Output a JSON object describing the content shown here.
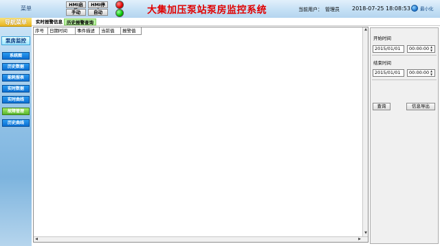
{
  "header": {
    "menu_label": "菜单",
    "buttons": [
      "HMI启动",
      "HMI停止",
      "手动",
      "自动"
    ],
    "title": "大集加压泵站泵房监控系统",
    "user_label": "当前用户：",
    "user_name": "管理员",
    "datetime": "2018-07-25 18:08:53",
    "minimize_label": "最小化",
    "lamp_colors": [
      "#e00000",
      "#00c000"
    ]
  },
  "sidebar": {
    "title": "导航菜单",
    "section": "泵房监控",
    "items": [
      {
        "label": "系统图",
        "active": false
      },
      {
        "label": "历史数据",
        "active": false
      },
      {
        "label": "能耗报表",
        "active": false
      },
      {
        "label": "实时数据",
        "active": false
      },
      {
        "label": "实时曲线",
        "active": false
      },
      {
        "label": "故障管理",
        "active": true
      },
      {
        "label": "历史曲线",
        "active": false
      }
    ]
  },
  "tabs": [
    {
      "label": "实时报警信息",
      "active": false
    },
    {
      "label": "历史报警查询",
      "active": true
    }
  ],
  "table": {
    "columns": [
      "序号",
      "日期时间",
      "事件描述",
      "当前值",
      "报警值"
    ],
    "rows": []
  },
  "query": {
    "start_label": "开始时间",
    "start_date": "2015/01/01",
    "start_time": "00:00:00",
    "end_label": "结束时间",
    "end_date": "2015/01/01",
    "end_time": "00:00:00",
    "search_button": "查询",
    "export_button": "信息导出"
  }
}
